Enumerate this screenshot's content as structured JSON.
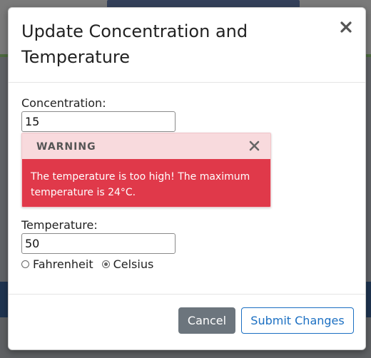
{
  "modal": {
    "title": "Update Concentration and Temperature",
    "concentration_label": "Concentration:",
    "concentration_value": "15",
    "temperature_label": "Temperature:",
    "temperature_value": "50",
    "unit_options": [
      {
        "label": "Fahrenheit",
        "selected": false
      },
      {
        "label": "Celsius",
        "selected": true
      }
    ],
    "cancel_label": "Cancel",
    "submit_label": "Submit Changes"
  },
  "warning": {
    "title": "WARNING",
    "message": "The temperature is too high! The maximum temperature is 24°C.",
    "header_color": "#f8dadd",
    "body_color": "#e0394a"
  },
  "colors": {
    "cancel_bg": "#6c757d",
    "submit_accent": "#1b6fc2"
  },
  "icons": {
    "modal_close": "close-icon",
    "warning_close": "close-icon"
  }
}
